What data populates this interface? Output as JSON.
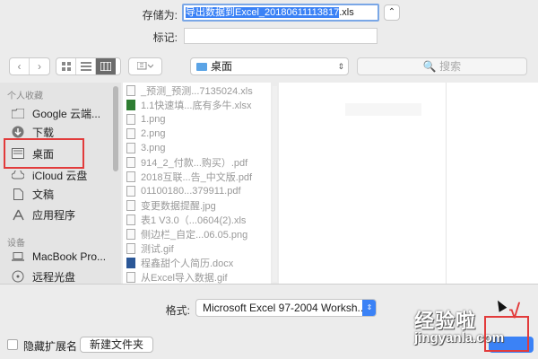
{
  "save_as": {
    "label": "存储为:",
    "filename": "导出数据到Excel_20180611113817",
    "extension": ".xls",
    "expand_icon": "chevron-up-icon"
  },
  "tags": {
    "label": "标记:",
    "value": ""
  },
  "toolbar": {
    "back_icon": "chevron-left-icon",
    "forward_icon": "chevron-right-icon",
    "view_icons": [
      "icon-view-icon",
      "list-view-icon",
      "column-view-icon",
      "gallery-view-icon"
    ],
    "location": "桌面",
    "search_placeholder": "搜索"
  },
  "sidebar": {
    "favorites_header": "个人收藏",
    "favorites": [
      {
        "label": "Google 云端...",
        "icon": "folder-icon"
      },
      {
        "label": "下载",
        "icon": "download-icon"
      },
      {
        "label": "桌面",
        "icon": "desktop-icon"
      },
      {
        "label": "iCloud 云盘",
        "icon": "cloud-icon"
      },
      {
        "label": "文稿",
        "icon": "document-icon"
      },
      {
        "label": "应用程序",
        "icon": "apps-icon"
      }
    ],
    "devices_header": "设备",
    "devices": [
      {
        "label": "MacBook Pro...",
        "icon": "laptop-icon"
      },
      {
        "label": "远程光盘",
        "icon": "disc-icon"
      }
    ]
  },
  "files": [
    {
      "name": "_预测_预测...7135024.xls",
      "type": "xls"
    },
    {
      "name": "1.1快速填...底有多牛.xlsx",
      "type": "xl"
    },
    {
      "name": "1.png",
      "type": "img"
    },
    {
      "name": "2.png",
      "type": "img"
    },
    {
      "name": "3.png",
      "type": "img"
    },
    {
      "name": "914_2_付款...购买）.pdf",
      "type": "pdf"
    },
    {
      "name": "2018互联...告_中文版.pdf",
      "type": "pdf"
    },
    {
      "name": "01100180...379911.pdf",
      "type": "pdf"
    },
    {
      "name": "变更数据提醒.jpg",
      "type": "img"
    },
    {
      "name": "表1 V3.0（...0604(2).xls",
      "type": "xls"
    },
    {
      "name": "侧边栏_自定...06.05.png",
      "type": "img"
    },
    {
      "name": "测试.gif",
      "type": "img"
    },
    {
      "name": "程鑫甜个人简历.docx",
      "type": "wd"
    },
    {
      "name": "从Excel导入数据.gif",
      "type": "img"
    }
  ],
  "format": {
    "label": "格式:",
    "selected": "Microsoft Excel 97-2004 Worksh..."
  },
  "bottom": {
    "hide_ext_label": "隐藏扩展名",
    "new_folder_label": "新建文件夹"
  },
  "watermark": {
    "main": "经验啦",
    "check": "√",
    "url": "jingyanla.com"
  }
}
